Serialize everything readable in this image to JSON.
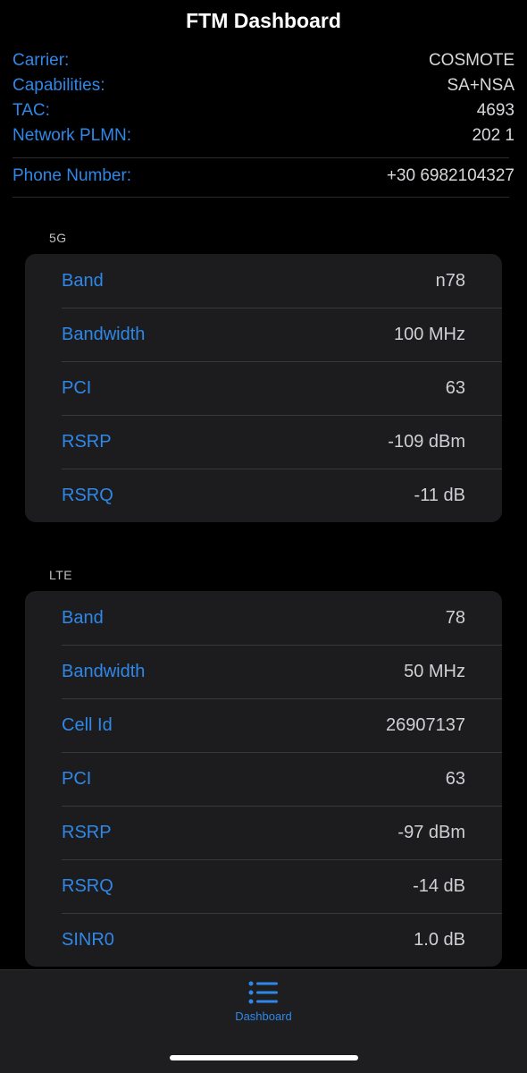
{
  "header": {
    "title": "FTM Dashboard"
  },
  "info": [
    {
      "label": "Carrier:",
      "value": "COSMOTE"
    },
    {
      "label": "Capabilities:",
      "value": "SA+NSA"
    },
    {
      "label": "TAC:",
      "value": "4693"
    },
    {
      "label": "Network PLMN:",
      "value": "202 1"
    },
    {
      "label": "Phone Number:",
      "value": "+30 6982104327"
    }
  ],
  "sections": {
    "nr": {
      "label": "5G",
      "rows": [
        {
          "label": "Band",
          "value": "n78"
        },
        {
          "label": "Bandwidth",
          "value": "100 MHz"
        },
        {
          "label": "PCI",
          "value": "63"
        },
        {
          "label": "RSRP",
          "value": "-109 dBm"
        },
        {
          "label": "RSRQ",
          "value": "-11 dB"
        }
      ]
    },
    "lte": {
      "label": "LTE",
      "rows": [
        {
          "label": "Band",
          "value": "78"
        },
        {
          "label": "Bandwidth",
          "value": "50 MHz"
        },
        {
          "label": "Cell Id",
          "value": "26907137"
        },
        {
          "label": "PCI",
          "value": "63"
        },
        {
          "label": "RSRP",
          "value": "-97 dBm"
        },
        {
          "label": "RSRQ",
          "value": "-14 dB"
        },
        {
          "label": "SINR0",
          "value": "1.0 dB"
        }
      ]
    }
  },
  "tabbar": {
    "tabs": [
      {
        "label": "Dashboard",
        "icon": "list-icon"
      }
    ]
  },
  "colors": {
    "accent": "#2f88e8",
    "background": "#000000",
    "card": "#1c1c1e"
  }
}
